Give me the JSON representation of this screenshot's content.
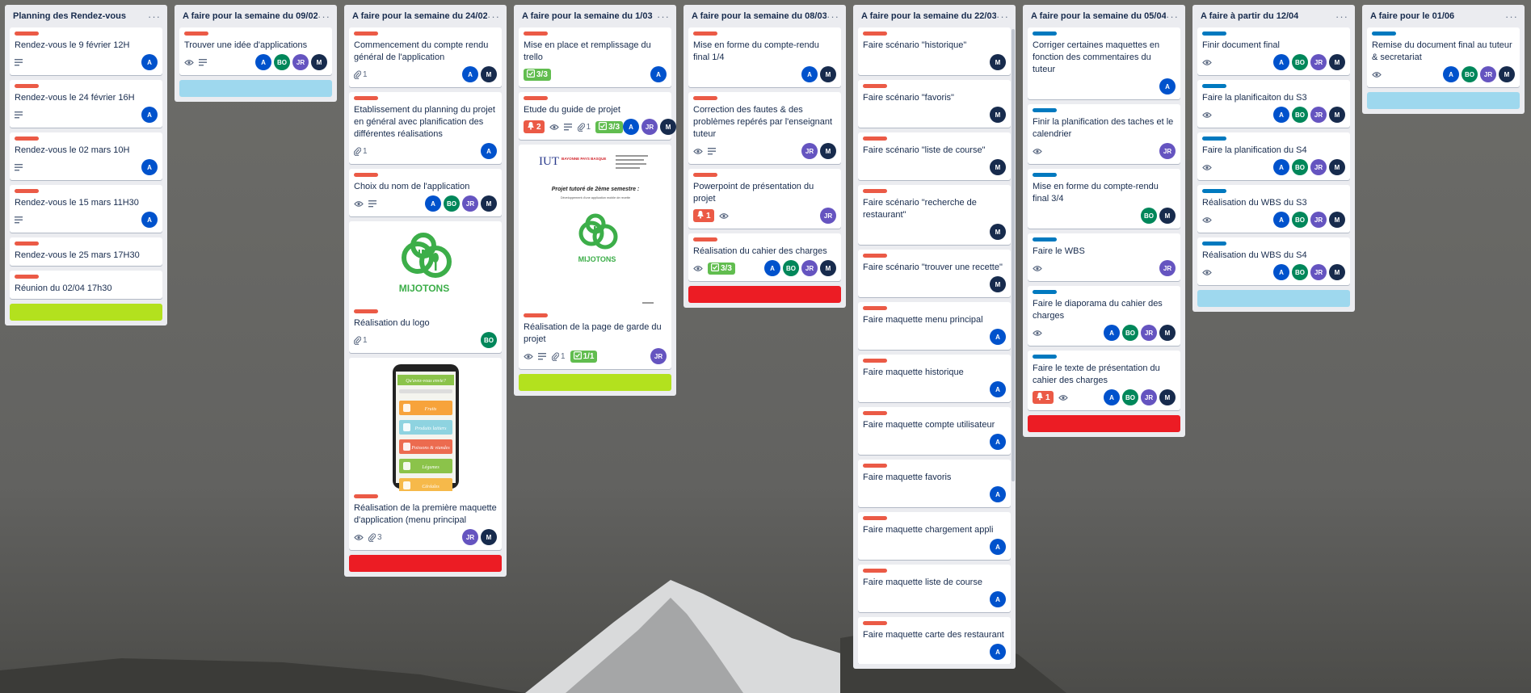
{
  "board": {
    "colors": {
      "lime": "#b3e11e",
      "red": "#ec1c24",
      "sky": "#9ed8ee",
      "label_red": "#eb5a46",
      "label_blue": "#0079bf"
    },
    "lists": [
      {
        "title": "Planning des Rendez-vous",
        "menu": "···",
        "cards": [
          {
            "title": "Rendez-vous le 9 février 12H",
            "label": "red",
            "icons": [
              "description-icon"
            ],
            "members": [
              "A"
            ]
          },
          {
            "title": "Rendez-vous le 24 février 16H",
            "label": "red",
            "icons": [
              "description-icon"
            ],
            "members": [
              "A"
            ]
          },
          {
            "title": "Rendez-vous le 02 mars 10H",
            "label": "red",
            "icons": [
              "description-icon"
            ],
            "members": [
              "A"
            ]
          },
          {
            "title": "Rendez-vous le 15 mars 11H30",
            "label": "red",
            "icons": [
              "description-icon"
            ],
            "members": [
              "A"
            ]
          },
          {
            "title": "Rendez-vous le 25 mars 17H30",
            "label": "red",
            "icons": [],
            "members": []
          },
          {
            "title": "Réunion du 02/04 17h30",
            "label": "red",
            "icons": [],
            "members": []
          }
        ],
        "color_card": "lime"
      },
      {
        "title": "A faire pour la semaine du 09/02",
        "menu": "···",
        "cards": [
          {
            "title": "Trouver une idée d'applications",
            "label": "red",
            "icons": [
              "eye-icon",
              "description-icon"
            ],
            "members": [
              "A",
              "BO",
              "JR",
              "M"
            ]
          }
        ],
        "color_card": "sky"
      },
      {
        "title": "A faire pour la semaine du 24/02",
        "menu": "···",
        "cards": [
          {
            "title": "Commencement du compte rendu général de l'application",
            "label": "red",
            "icons": [
              "attachment-icon"
            ],
            "attachments": "1",
            "members": [
              "A",
              "M"
            ]
          },
          {
            "title": "Etablissement du planning du projet en général avec planification des différentes réalisations",
            "label": "red",
            "icons": [
              "attachment-icon"
            ],
            "attachments": "1",
            "members": [
              "A"
            ]
          },
          {
            "title": "Choix du nom de l'application",
            "label": "red",
            "icons": [
              "eye-icon",
              "description-icon"
            ],
            "members": [
              "A",
              "BO",
              "JR",
              "M"
            ]
          },
          {
            "title": "Réalisation du logo",
            "label": "red",
            "cover": "logo",
            "icons": [
              "attachment-icon"
            ],
            "attachments": "1",
            "members": [
              "BO"
            ]
          },
          {
            "title": "Réalisation de la première maquette d'application (menu principal",
            "label": "red",
            "cover": "phone",
            "icons": [
              "eye-icon",
              "attachment-icon"
            ],
            "attachments": "3",
            "members": [
              "JR",
              "M"
            ]
          }
        ],
        "color_card": "red"
      },
      {
        "title": "A faire pour la semaine du 1/03",
        "menu": "···",
        "cards": [
          {
            "title": "Mise en place et remplissage du trello",
            "label": "red",
            "checklist": "3/3",
            "members": [
              "A"
            ]
          },
          {
            "title": "Etude du guide de projet",
            "label": "red",
            "due": "2",
            "icons": [
              "eye-icon",
              "description-icon",
              "attachment-icon"
            ],
            "attachments": "1",
            "checklist": "3/3",
            "members": [
              "A",
              "JR",
              "M"
            ]
          },
          {
            "title": "Réalisation de la page de garde du projet",
            "label": "red",
            "cover": "document",
            "icons": [
              "eye-icon",
              "description-icon",
              "attachment-icon"
            ],
            "attachments": "1",
            "checklist": "1/1",
            "members": [
              "JR"
            ]
          }
        ],
        "color_card": "lime"
      },
      {
        "title": "A faire pour la semaine du 08/03",
        "menu": "···",
        "cards": [
          {
            "title": "Mise en forme du compte-rendu final 1/4",
            "label": "red",
            "icons": [],
            "members": [
              "A",
              "M"
            ]
          },
          {
            "title": "Correction des fautes & des problèmes repérés par l'enseignant tuteur",
            "label": "red",
            "icons": [
              "eye-icon",
              "description-icon"
            ],
            "members": [
              "JR",
              "M"
            ]
          },
          {
            "title": "Powerpoint de présentation du projet",
            "label": "red",
            "due": "1",
            "icons": [
              "eye-icon"
            ],
            "members": [
              "JR"
            ]
          },
          {
            "title": "Réalisation du cahier des charges",
            "label": "red",
            "icons": [
              "eye-icon"
            ],
            "checklist": "3/3",
            "members": [
              "A",
              "BO",
              "JR",
              "M"
            ]
          }
        ],
        "color_card": "red"
      },
      {
        "title": "A faire pour la semaine du 22/03",
        "menu": "···",
        "cards": [
          {
            "title": "Faire scénario \"historique\"",
            "label": "red",
            "icons": [],
            "members": [
              "M"
            ]
          },
          {
            "title": "Faire scénario \"favoris\"",
            "label": "red",
            "icons": [],
            "members": [
              "M"
            ]
          },
          {
            "title": "Faire scénario \"liste de course\"",
            "label": "red",
            "icons": [],
            "members": [
              "M"
            ]
          },
          {
            "title": "Faire scénario \"recherche de restaurant\"",
            "label": "red",
            "icons": [],
            "members": [
              "M"
            ]
          },
          {
            "title": "Faire scénario \"trouver une recette\"",
            "label": "red",
            "icons": [],
            "members": [
              "M"
            ]
          },
          {
            "title": "Faire maquette menu principal",
            "label": "red",
            "icons": [],
            "members": [
              "A"
            ]
          },
          {
            "title": "Faire maquette historique",
            "label": "red",
            "icons": [],
            "members": [
              "A"
            ]
          },
          {
            "title": "Faire maquette compte utilisateur",
            "label": "red",
            "icons": [],
            "members": [
              "A"
            ]
          },
          {
            "title": "Faire maquette favoris",
            "label": "red",
            "icons": [],
            "members": [
              "A"
            ]
          },
          {
            "title": "Faire maquette chargement appli",
            "label": "red",
            "icons": [],
            "members": [
              "A"
            ]
          },
          {
            "title": "Faire maquette liste de course",
            "label": "red",
            "icons": [],
            "members": [
              "A"
            ]
          },
          {
            "title": "Faire maquette carte des restaurant",
            "label": "red",
            "icons": [],
            "members": [
              "A"
            ]
          }
        ],
        "color_card": "red"
      },
      {
        "title": "A faire pour la semaine du 05/04",
        "menu": "···",
        "cards": [
          {
            "title": "Corriger certaines maquettes en fonction des commentaires du tuteur",
            "label": "blue",
            "icons": [],
            "members": [
              "A"
            ]
          },
          {
            "title": "Finir la planification des taches et le calendrier",
            "label": "blue",
            "icons": [
              "eye-icon"
            ],
            "members": [
              "JR"
            ]
          },
          {
            "title": "Mise en forme du compte-rendu final 3/4",
            "label": "blue",
            "icons": [],
            "members": [
              "BO",
              "M"
            ]
          },
          {
            "title": "Faire le WBS",
            "label": "blue",
            "icons": [
              "eye-icon"
            ],
            "members": [
              "JR"
            ]
          },
          {
            "title": "Faire le diaporama du cahier des charges",
            "label": "blue",
            "icons": [
              "eye-icon"
            ],
            "members": [
              "A",
              "BO",
              "JR",
              "M"
            ]
          },
          {
            "title": "Faire le texte de présentation du cahier des charges",
            "label": "blue",
            "due": "1",
            "icons": [
              "eye-icon"
            ],
            "members": [
              "A",
              "BO",
              "JR",
              "M"
            ]
          }
        ],
        "color_card": "red"
      },
      {
        "title": "A faire à partir du 12/04",
        "menu": "···",
        "cards": [
          {
            "title": "Finir document final",
            "label": "blue",
            "icons": [
              "eye-icon"
            ],
            "members": [
              "A",
              "BO",
              "JR",
              "M"
            ]
          },
          {
            "title": "Faire la planificaiton du S3",
            "label": "blue",
            "icons": [
              "eye-icon"
            ],
            "members": [
              "A",
              "BO",
              "JR",
              "M"
            ]
          },
          {
            "title": "Faire la planification du S4",
            "label": "blue",
            "icons": [
              "eye-icon"
            ],
            "members": [
              "A",
              "BO",
              "JR",
              "M"
            ]
          },
          {
            "title": "Réalisation du WBS du S3",
            "label": "blue",
            "icons": [
              "eye-icon"
            ],
            "members": [
              "A",
              "BO",
              "JR",
              "M"
            ]
          },
          {
            "title": "Réalisation du WBS du S4",
            "label": "blue",
            "icons": [
              "eye-icon"
            ],
            "members": [
              "A",
              "BO",
              "JR",
              "M"
            ]
          }
        ],
        "color_card": "sky"
      },
      {
        "title": "A faire pour le 01/06",
        "menu": "···",
        "cards": [
          {
            "title": "Remise du document final au tuteur & secretariat",
            "label": "blue",
            "icons": [
              "eye-icon"
            ],
            "members": [
              "A",
              "BO",
              "JR",
              "M"
            ]
          }
        ],
        "color_card": "sky"
      }
    ],
    "covers": {
      "logo": {
        "wordmark": "MIJOTONS"
      },
      "phone": {
        "header": "Qu'avez-vous envie?",
        "menu": [
          "Fruits",
          "Produits laitiers",
          "Poissons & viandes",
          "Légumes",
          "Céréales"
        ],
        "menu_colors": [
          "#f7a33b",
          "#8ed3e0",
          "#ec6b4f",
          "#8bc34a",
          "#f6b94a"
        ]
      },
      "document": {
        "school": "IUT",
        "school_sub": "BAYONNE PAYS BASQUE",
        "heading": "Projet tutoré de 2ème semestre :",
        "subheading": "Développement d'une application mobile de recette",
        "wordmark": "MIJOTONS"
      }
    }
  }
}
